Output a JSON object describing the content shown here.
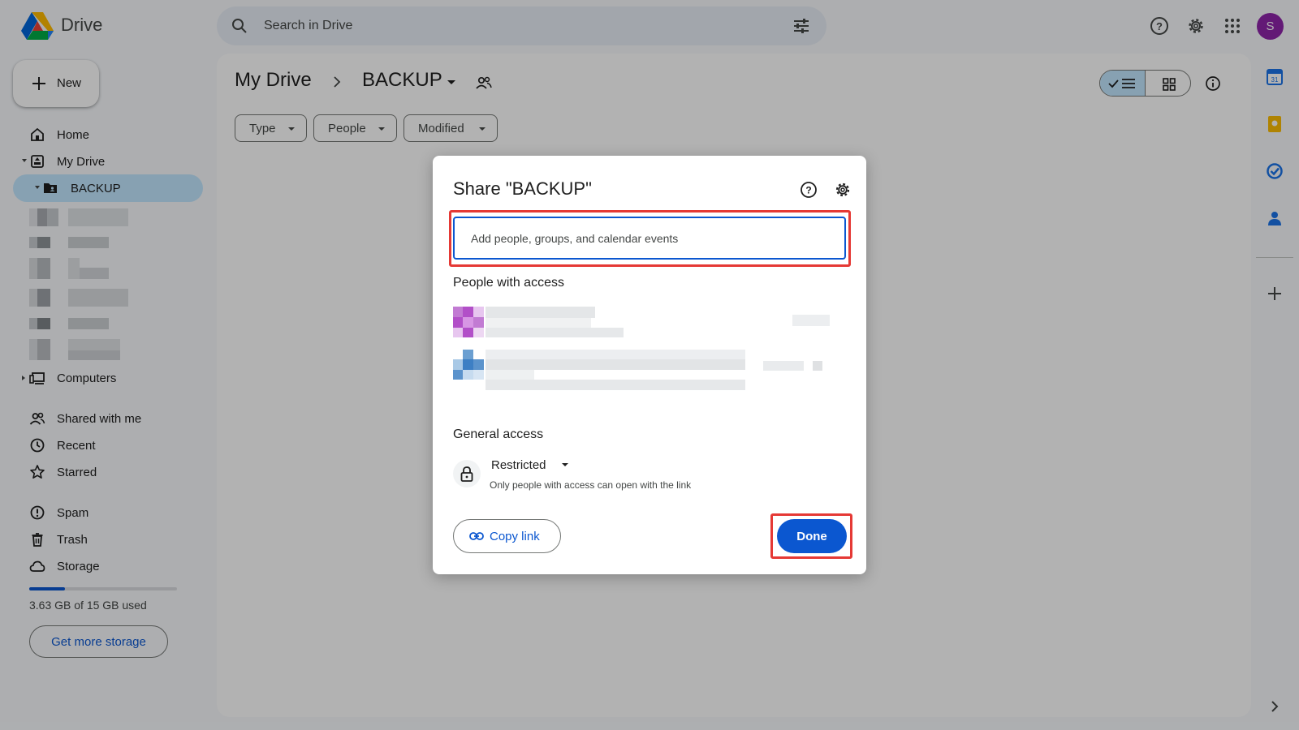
{
  "app": {
    "name": "Drive"
  },
  "search": {
    "placeholder": "Search in Drive"
  },
  "account": {
    "initial": "S",
    "avatar_color": "#8e24aa"
  },
  "sidebar": {
    "new_label": "New",
    "items": [
      {
        "label": "Home",
        "icon": "home-icon"
      },
      {
        "label": "My Drive",
        "icon": "my-drive-icon"
      },
      {
        "label": "BACKUP",
        "icon": "shared-folder-icon",
        "active": true
      },
      {
        "label": "Computers",
        "icon": "computers-icon"
      },
      {
        "label": "Shared with me",
        "icon": "shared-with-me-icon"
      },
      {
        "label": "Recent",
        "icon": "recent-icon"
      },
      {
        "label": "Starred",
        "icon": "star-icon"
      },
      {
        "label": "Spam",
        "icon": "spam-icon"
      },
      {
        "label": "Trash",
        "icon": "trash-icon"
      },
      {
        "label": "Storage",
        "icon": "cloud-icon"
      }
    ],
    "storage": {
      "used_text": "3.63 GB of 15 GB used",
      "used_fraction": 0.242,
      "cta": "Get more storage"
    }
  },
  "main": {
    "breadcrumb": [
      "My Drive",
      "BACKUP"
    ],
    "filters": [
      "Type",
      "People",
      "Modified"
    ]
  },
  "dialog": {
    "title": "Share \"BACKUP\"",
    "add_placeholder": "Add people, groups, and calendar events",
    "people_heading": "People with access",
    "general_heading": "General access",
    "access_level": "Restricted",
    "access_desc": "Only people with access can open with the link",
    "copy_link": "Copy link",
    "done": "Done"
  },
  "colors": {
    "accent": "#0b57d0",
    "active_nav": "#c2e7ff",
    "highlight": "#e53935"
  }
}
